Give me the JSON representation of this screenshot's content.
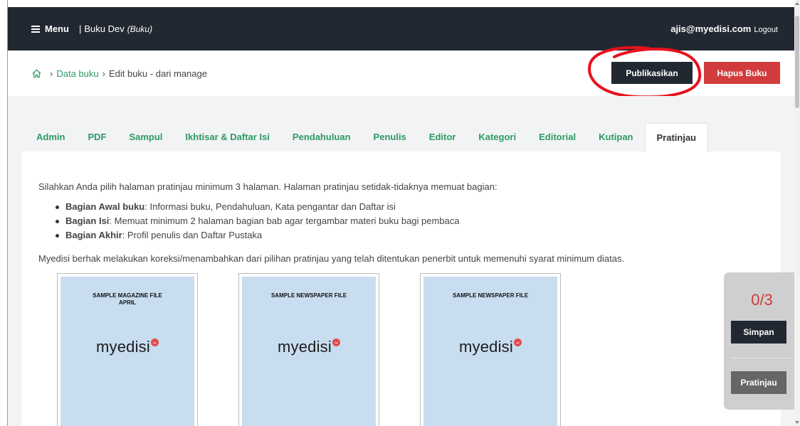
{
  "topbar": {
    "menu_label": "Menu",
    "separator": "|",
    "book_title": "Buku Dev",
    "book_type": "(Buku)",
    "user_email": "ajis@myedisi.com",
    "logout_label": "Logout"
  },
  "breadcrumb": {
    "sep": "›",
    "items": [
      "Data buku",
      "Edit buku - dari manage"
    ]
  },
  "actions": {
    "publish_label": "Publikasikan",
    "delete_label": "Hapus Buku"
  },
  "tabs": [
    {
      "label": "Admin"
    },
    {
      "label": "PDF"
    },
    {
      "label": "Sampul"
    },
    {
      "label": "Ikhtisar & Daftar Isi"
    },
    {
      "label": "Pendahuluan"
    },
    {
      "label": "Penulis"
    },
    {
      "label": "Editor"
    },
    {
      "label": "Kategori"
    },
    {
      "label": "Editorial"
    },
    {
      "label": "Kutipan"
    },
    {
      "label": "Pratinjau",
      "active": true
    }
  ],
  "content": {
    "intro": "Silahkan Anda pilih halaman pratinjau minimum 3 halaman. Halaman pratinjau setidak-tidaknya memuat bagian:",
    "rules": [
      {
        "title": "Bagian Awal buku",
        "text": ": Informasi buku, Pendahuluan, Kata pengantar dan Daftar isi"
      },
      {
        "title": "Bagian Isi",
        "text": ": Memuat minimum 2 halaman bagian bab agar tergambar materi buku bagi pembaca"
      },
      {
        "title": "Bagian Akhir",
        "text": ": Profil penulis dan Daftar Pustaka"
      }
    ],
    "note": "Myedisi berhak melakukan koreksi/menambahkan dari pilihan pratinjau yang telah ditentukan penerbit untuk memenuhi syarat minimum diatas."
  },
  "thumbnails": [
    {
      "caption": "SAMPLE MAGAZINE FILE\nAPRIL",
      "logo": "myedisi"
    },
    {
      "caption": "SAMPLE NEWSPAPER FILE",
      "logo": "myedisi"
    },
    {
      "caption": "SAMPLE NEWSPAPER FILE",
      "logo": "myedisi"
    }
  ],
  "floating": {
    "counter": "0/3",
    "save_label": "Simpan",
    "preview_label": "Pratinjau"
  },
  "colors": {
    "accent_green": "#2d9a63",
    "dark": "#222831",
    "danger": "#d23b3b",
    "highlight_ring": "#e8111d"
  }
}
